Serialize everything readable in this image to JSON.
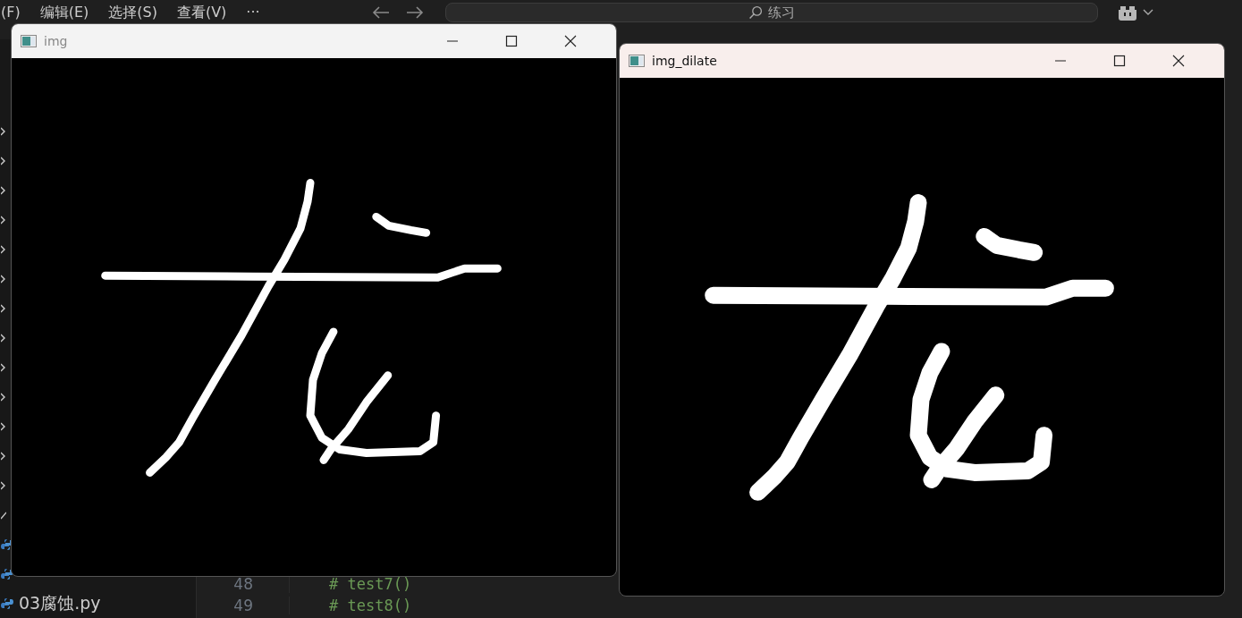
{
  "menu": [
    {
      "label": "(F)"
    },
    {
      "label": "编辑(E)"
    },
    {
      "label": "选择(S)"
    },
    {
      "label": "查看(V)"
    },
    {
      "label": "···"
    }
  ],
  "search": {
    "placeholder": "练习"
  },
  "sidebar": {
    "files": [
      {
        "name": "03腐蚀.py"
      }
    ]
  },
  "editor": {
    "lines": [
      {
        "number": "48",
        "code": "# test7()"
      },
      {
        "number": "49",
        "code": "# test8()"
      }
    ]
  },
  "windows": [
    {
      "title": "img",
      "active": false
    },
    {
      "title": "img_dilate",
      "active": true
    }
  ]
}
